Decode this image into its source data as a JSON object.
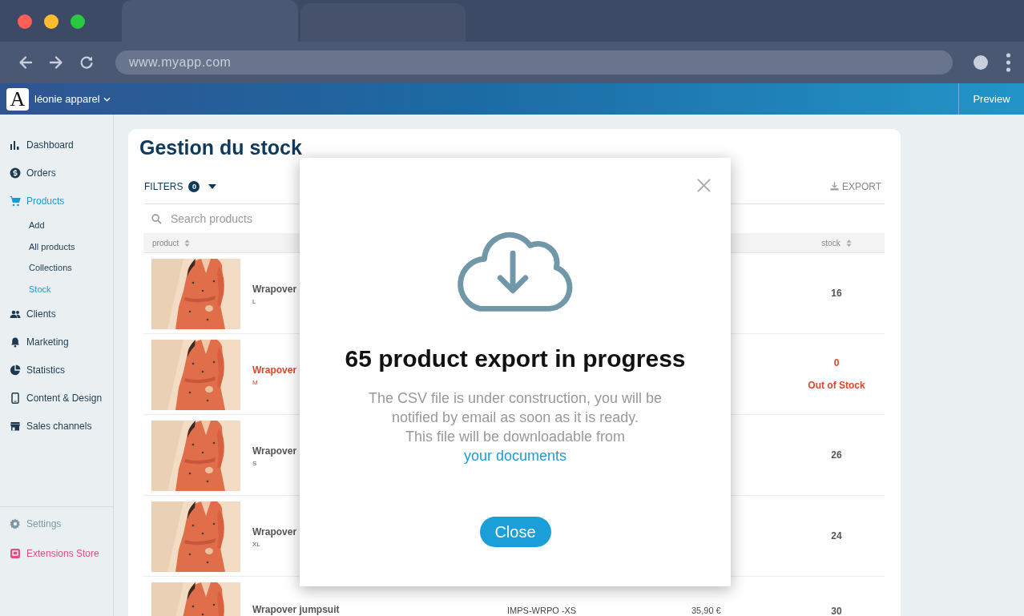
{
  "browser": {
    "url": "www.myapp.com"
  },
  "header": {
    "logo_letter": "A",
    "shop_name": "léonie apparel",
    "preview_label": "Preview"
  },
  "sidebar": {
    "items": [
      {
        "label": "Dashboard",
        "selected": false
      },
      {
        "label": "Orders",
        "selected": false
      },
      {
        "label": "Products",
        "selected": true,
        "children": [
          {
            "label": "Add",
            "selected": false
          },
          {
            "label": "All products",
            "selected": false
          },
          {
            "label": "Collections",
            "selected": false
          },
          {
            "label": "Stock",
            "selected": true
          }
        ]
      },
      {
        "label": "Clients",
        "selected": false
      },
      {
        "label": "Marketing",
        "selected": false
      },
      {
        "label": "Statistics",
        "selected": false
      },
      {
        "label": "Content & Design",
        "selected": false
      },
      {
        "label": "Sales channels",
        "selected": false
      }
    ],
    "footer": [
      {
        "label": "Settings",
        "color": "#7f97a3"
      },
      {
        "label": "Extensions Store",
        "color": "#e0507f"
      }
    ]
  },
  "page": {
    "title": "Gestion du stock",
    "filters_label": "FILTERS",
    "filters_count": "0",
    "export_label": "EXPORT",
    "search": {
      "placeholder": "Search products"
    }
  },
  "table": {
    "columns": [
      {
        "label": "product"
      },
      {
        "label": "stock"
      }
    ],
    "rows": [
      {
        "name": "Wrapover",
        "size": "L",
        "stock": "16",
        "out_of_stock": false
      },
      {
        "name": "Wrapover",
        "size": "M",
        "stock": "0",
        "stock_note": "Out of Stock",
        "out_of_stock": true
      },
      {
        "name": "Wrapover",
        "size": "S",
        "stock": "26",
        "out_of_stock": false
      },
      {
        "name": "Wrapover",
        "size": "XL",
        "stock": "24",
        "out_of_stock": false
      },
      {
        "name": "Wrapover jumpsuit",
        "sku": "IMPS-WRPO -XS",
        "price": "35,90 €",
        "stock": "30",
        "out_of_stock": false
      }
    ]
  },
  "modal": {
    "title": "65 product export in progress",
    "message": "The CSV file is under construction, you will be notified by email as soon as it is ready.",
    "message_2": "This file will be downloadable from",
    "link": "your documents",
    "button": "Close"
  }
}
